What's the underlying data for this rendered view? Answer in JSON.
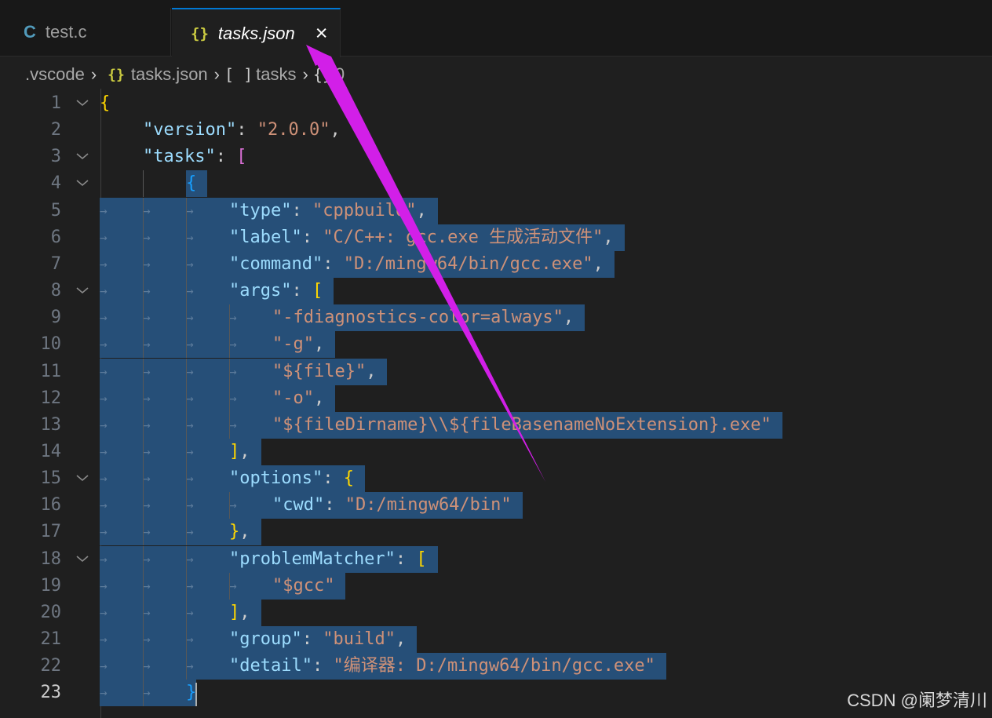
{
  "tabs": [
    {
      "icon": "C",
      "label": "test.c"
    },
    {
      "icon": "{}",
      "label": "tasks.json",
      "close": "×"
    }
  ],
  "breadcrumb": {
    "folder": ".vscode",
    "file_icon": "{}",
    "file": "tasks.json",
    "array_icon": "[ ]",
    "array": "tasks",
    "object_icon": "{}",
    "object": "0"
  },
  "editor": {
    "active_line": 23,
    "lines": [
      {
        "n": "1",
        "fold": true,
        "ind": 0,
        "tokens": [
          {
            "t": "{",
            "c": "b1"
          }
        ]
      },
      {
        "n": "2",
        "ind": 1,
        "tokens": [
          {
            "t": "\"version\"",
            "c": "k"
          },
          {
            "t": ": ",
            "c": "p"
          },
          {
            "t": "\"2.0.0\"",
            "c": "s"
          },
          {
            "t": ",",
            "c": "p"
          }
        ]
      },
      {
        "n": "3",
        "fold": true,
        "ind": 1,
        "tokens": [
          {
            "t": "\"tasks\"",
            "c": "k"
          },
          {
            "t": ": ",
            "c": "p"
          },
          {
            "t": "[",
            "c": "b2"
          }
        ]
      },
      {
        "n": "4",
        "fold": true,
        "ind": 2,
        "tokens": [
          {
            "t": "{",
            "c": "b3"
          }
        ]
      },
      {
        "n": "5",
        "ind": 3,
        "tokens": [
          {
            "t": "\"type\"",
            "c": "k"
          },
          {
            "t": ": ",
            "c": "p"
          },
          {
            "t": "\"cppbuild\"",
            "c": "s"
          },
          {
            "t": ",",
            "c": "p"
          }
        ]
      },
      {
        "n": "6",
        "ind": 3,
        "tokens": [
          {
            "t": "\"label\"",
            "c": "k"
          },
          {
            "t": ": ",
            "c": "p"
          },
          {
            "t": "\"C/C++: gcc.exe 生成活动文件\"",
            "c": "s"
          },
          {
            "t": ",",
            "c": "p"
          }
        ]
      },
      {
        "n": "7",
        "ind": 3,
        "tokens": [
          {
            "t": "\"command\"",
            "c": "k"
          },
          {
            "t": ": ",
            "c": "p"
          },
          {
            "t": "\"D:/mingw64/bin/gcc.exe\"",
            "c": "s"
          },
          {
            "t": ",",
            "c": "p"
          }
        ]
      },
      {
        "n": "8",
        "fold": true,
        "ind": 3,
        "tokens": [
          {
            "t": "\"args\"",
            "c": "k"
          },
          {
            "t": ": ",
            "c": "p"
          },
          {
            "t": "[",
            "c": "b1"
          }
        ]
      },
      {
        "n": "9",
        "ind": 4,
        "tokens": [
          {
            "t": "\"-fdiagnostics-color=always\"",
            "c": "s"
          },
          {
            "t": ",",
            "c": "p"
          }
        ]
      },
      {
        "n": "10",
        "ind": 4,
        "tokens": [
          {
            "t": "\"-g\"",
            "c": "s"
          },
          {
            "t": ",",
            "c": "p"
          }
        ]
      },
      {
        "n": "11",
        "ind": 4,
        "tokens": [
          {
            "t": "\"${file}\"",
            "c": "s"
          },
          {
            "t": ",",
            "c": "p"
          }
        ]
      },
      {
        "n": "12",
        "ind": 4,
        "tokens": [
          {
            "t": "\"-o\"",
            "c": "s"
          },
          {
            "t": ",",
            "c": "p"
          }
        ]
      },
      {
        "n": "13",
        "ind": 4,
        "tokens": [
          {
            "t": "\"${fileDirname}\\\\${fileBasenameNoExtension}.exe\"",
            "c": "s"
          }
        ]
      },
      {
        "n": "14",
        "ind": 3,
        "tokens": [
          {
            "t": "]",
            "c": "b1"
          },
          {
            "t": ",",
            "c": "p"
          }
        ]
      },
      {
        "n": "15",
        "fold": true,
        "ind": 3,
        "tokens": [
          {
            "t": "\"options\"",
            "c": "k"
          },
          {
            "t": ": ",
            "c": "p"
          },
          {
            "t": "{",
            "c": "b1"
          }
        ]
      },
      {
        "n": "16",
        "ind": 4,
        "tokens": [
          {
            "t": "\"cwd\"",
            "c": "k"
          },
          {
            "t": ": ",
            "c": "p"
          },
          {
            "t": "\"D:/mingw64/bin\"",
            "c": "s"
          }
        ]
      },
      {
        "n": "17",
        "ind": 3,
        "tokens": [
          {
            "t": "}",
            "c": "b1"
          },
          {
            "t": ",",
            "c": "p"
          }
        ]
      },
      {
        "n": "18",
        "fold": true,
        "ind": 3,
        "tokens": [
          {
            "t": "\"problemMatcher\"",
            "c": "k"
          },
          {
            "t": ": ",
            "c": "p"
          },
          {
            "t": "[",
            "c": "b1"
          }
        ]
      },
      {
        "n": "19",
        "ind": 4,
        "tokens": [
          {
            "t": "\"$gcc\"",
            "c": "s"
          }
        ]
      },
      {
        "n": "20",
        "ind": 3,
        "tokens": [
          {
            "t": "]",
            "c": "b1"
          },
          {
            "t": ",",
            "c": "p"
          }
        ]
      },
      {
        "n": "21",
        "ind": 3,
        "tokens": [
          {
            "t": "\"group\"",
            "c": "k"
          },
          {
            "t": ": ",
            "c": "p"
          },
          {
            "t": "\"build\"",
            "c": "s"
          },
          {
            "t": ",",
            "c": "p"
          }
        ]
      },
      {
        "n": "22",
        "ind": 3,
        "tokens": [
          {
            "t": "\"detail\"",
            "c": "k"
          },
          {
            "t": ": ",
            "c": "p"
          },
          {
            "t": "\"编译器: D:/mingw64/bin/gcc.exe\"",
            "c": "s"
          }
        ]
      },
      {
        "n": "23",
        "ind": 2,
        "tokens": [
          {
            "t": "}",
            "c": "b3"
          }
        ]
      }
    ]
  },
  "watermark": "CSDN @阑梦清川",
  "colors": {
    "annotation_arrow": "#d21fe8",
    "selection": "#264f78",
    "tab_active_border": "#0078d4"
  }
}
